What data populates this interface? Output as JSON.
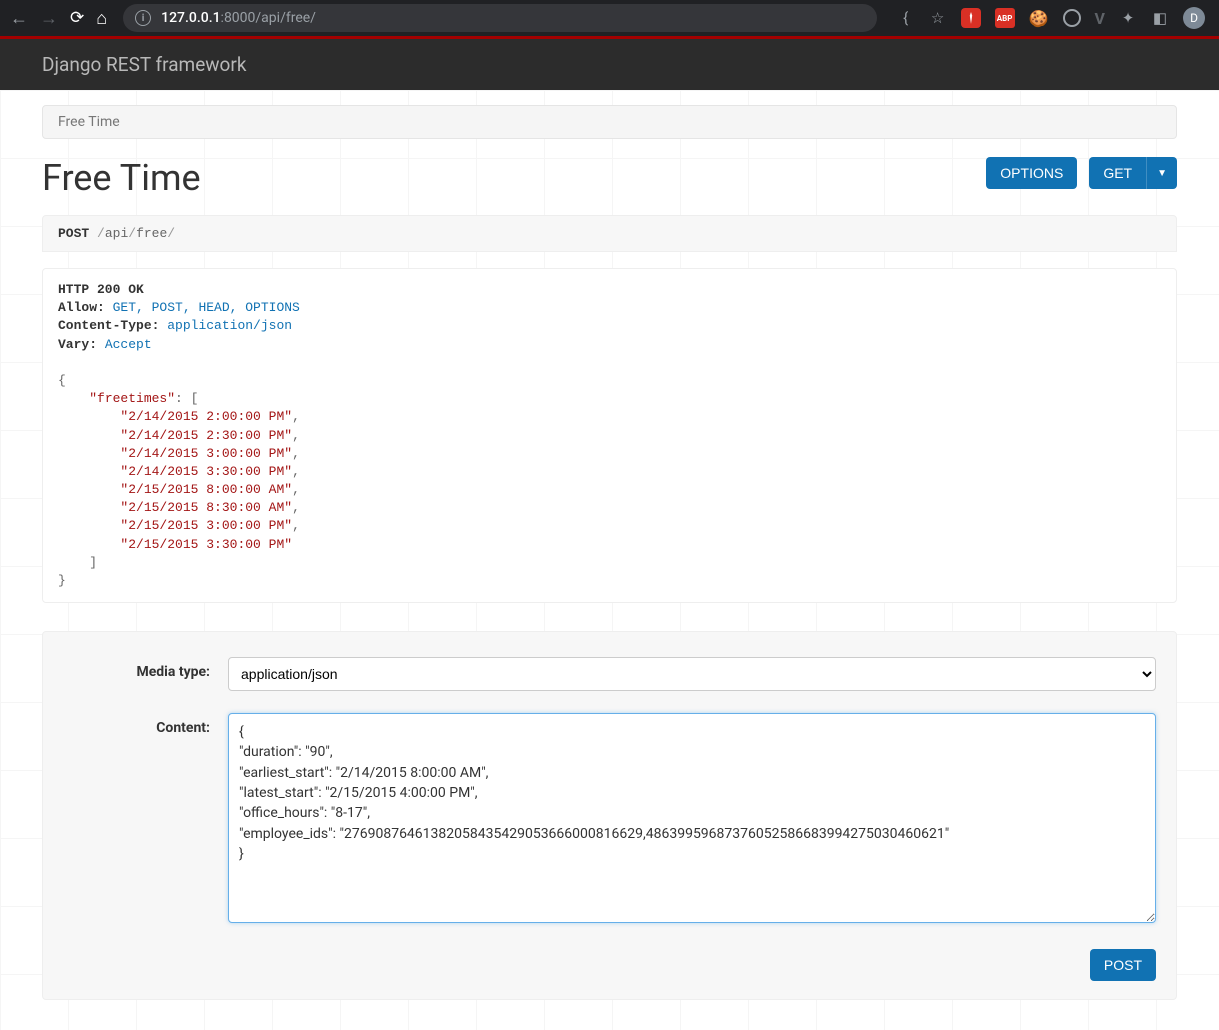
{
  "browser": {
    "url_host": "127.0.0.1",
    "url_rest": ":8000/api/free/",
    "avatar_letter": "D",
    "abp_label": "ABP"
  },
  "navbar": {
    "brand": "Django REST framework"
  },
  "breadcrumb": {
    "current": "Free Time"
  },
  "page": {
    "title": "Free Time",
    "options_label": "OPTIONS",
    "get_label": "GET"
  },
  "request": {
    "method": "POST",
    "path_parts": [
      "/",
      "api",
      "/",
      "free",
      "/"
    ]
  },
  "response": {
    "status_line": "HTTP 200 OK",
    "headers": [
      {
        "name": "Allow:",
        "value": "GET, POST, HEAD, OPTIONS"
      },
      {
        "name": "Content-Type:",
        "value": "application/json"
      },
      {
        "name": "Vary:",
        "value": "Accept"
      }
    ],
    "body_key": "\"freetimes\"",
    "body_values": [
      "\"2/14/2015 2:00:00 PM\"",
      "\"2/14/2015 2:30:00 PM\"",
      "\"2/14/2015 3:00:00 PM\"",
      "\"2/14/2015 3:30:00 PM\"",
      "\"2/15/2015 8:00:00 AM\"",
      "\"2/15/2015 8:30:00 AM\"",
      "\"2/15/2015 3:00:00 PM\"",
      "\"2/15/2015 3:30:00 PM\""
    ]
  },
  "form": {
    "media_type_label": "Media type:",
    "media_type_value": "application/json",
    "content_label": "Content:",
    "content_value": "{\n\"duration\": \"90\",\n\"earliest_start\": \"2/14/2015 8:00:00 AM\",\n\"latest_start\": \"2/15/2015 4:00:00 PM\",\n\"office_hours\": \"8-17\",\n\"employee_ids\": \"27690876461382058435429053666000816629,48639959687376052586683994275030460621\"\n}",
    "post_label": "POST"
  }
}
